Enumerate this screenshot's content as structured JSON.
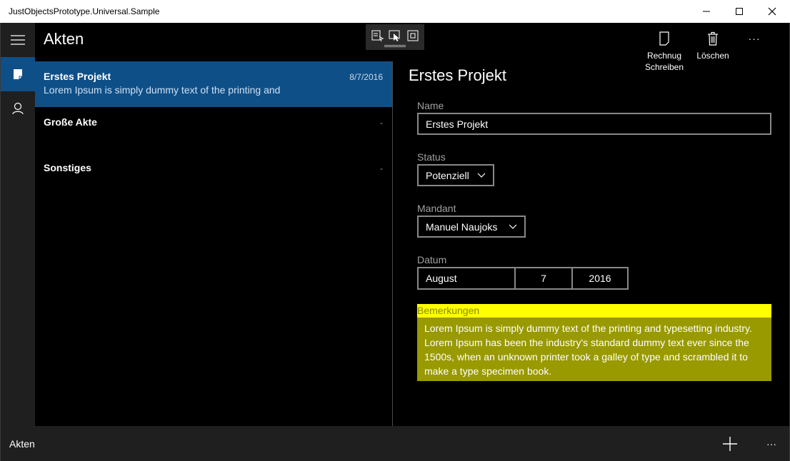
{
  "window": {
    "title": "JustObjectsPrototype.Universal.Sample"
  },
  "header": {
    "title": "Akten"
  },
  "nav": {
    "items": [
      {
        "icon": "hamburger-icon"
      },
      {
        "icon": "document-icon",
        "active": true
      },
      {
        "icon": "person-icon"
      }
    ]
  },
  "list": {
    "items": [
      {
        "title": "Erstes Projekt",
        "date": "8/7/2016",
        "subtitle": "Lorem Ipsum is simply dummy text of the printing and",
        "selected": true
      },
      {
        "title": "Große Akte",
        "date": "-",
        "subtitle": ""
      },
      {
        "title": "Sonstiges",
        "date": "-",
        "subtitle": ""
      }
    ]
  },
  "commands": {
    "invoice_label_1": "Rechnug",
    "invoice_label_2": "Schreiben",
    "delete_label": "Löschen",
    "more_label": "···"
  },
  "detail": {
    "title": "Erstes Projekt",
    "name_label": "Name",
    "name_value": "Erstes Projekt",
    "status_label": "Status",
    "status_value": "Potenziell",
    "client_label": "Mandant",
    "client_value": "Manuel Naujoks",
    "date_label": "Datum",
    "date_month": "August",
    "date_day": "7",
    "date_year": "2016",
    "notes_label": "Bemerkungen",
    "notes_value": "Lorem Ipsum is simply dummy text of the printing and typesetting industry. Lorem Ipsum has been the industry's standard dummy text ever since the 1500s, when an unknown printer took a galley of type and scrambled it to make a type specimen book."
  },
  "bottom": {
    "title": "Akten",
    "add_icon": "plus-icon",
    "more_label": "···"
  },
  "colors": {
    "accent": "#0f4f87",
    "highlight_label": "#ffff00",
    "highlight_body": "#999900"
  }
}
